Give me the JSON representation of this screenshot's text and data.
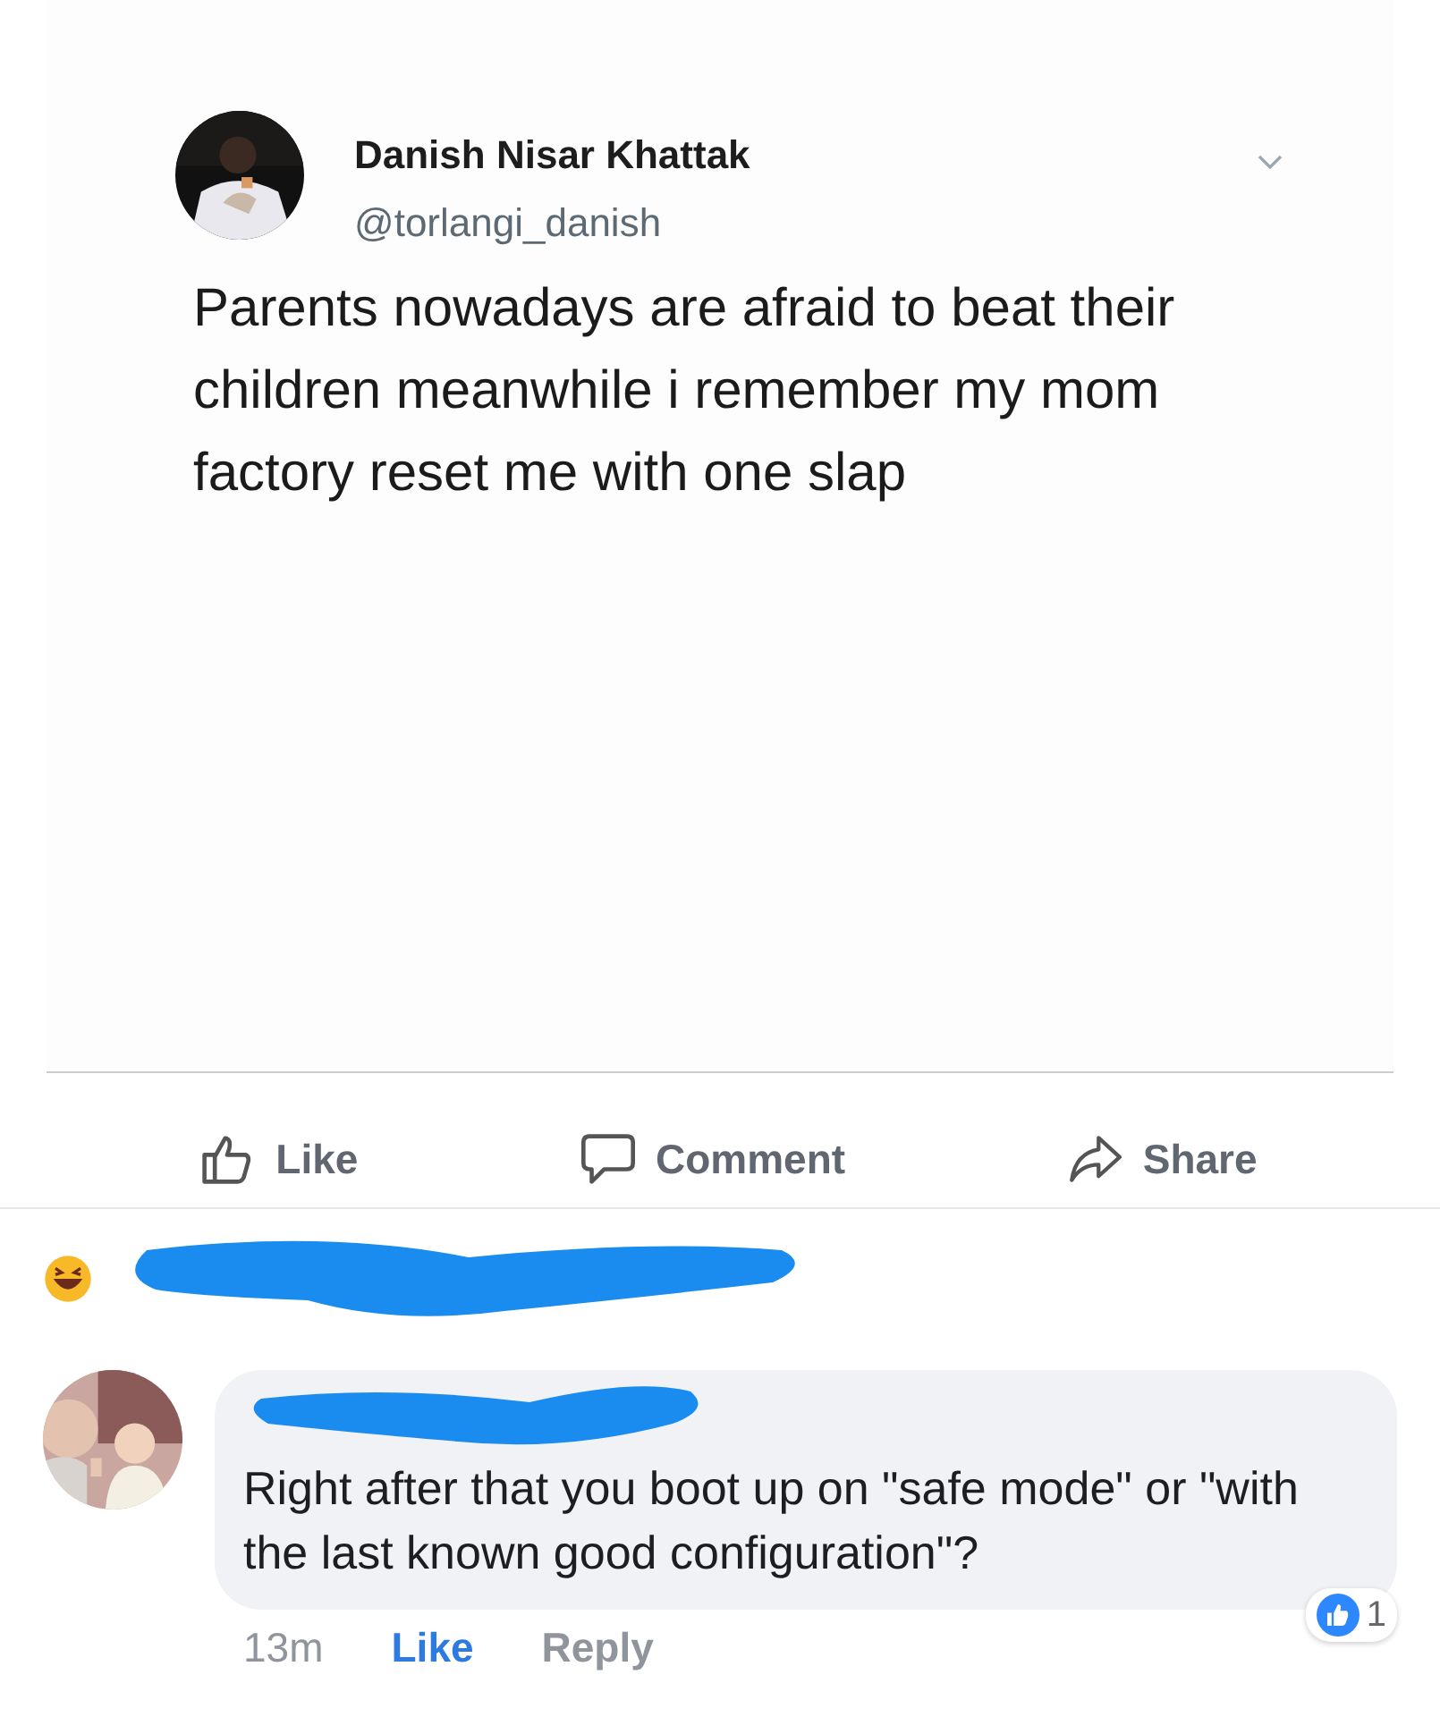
{
  "tweet": {
    "name": "Danish Nisar Khattak",
    "handle": "@torlangi_danish",
    "text": "Parents nowadays are afraid to beat their children meanwhile i remember my mom factory reset me with one slap"
  },
  "actions": [
    {
      "kind": "like",
      "label": "Like"
    },
    {
      "kind": "comment",
      "label": "Comment"
    },
    {
      "kind": "share",
      "label": "Share"
    }
  ],
  "comment": {
    "text": "Right after that you boot up on \"safe mode\" or \"with the last known good configuration\"?",
    "time": "13m",
    "like": "Like",
    "reply": "Reply",
    "reaction_count": "1"
  }
}
